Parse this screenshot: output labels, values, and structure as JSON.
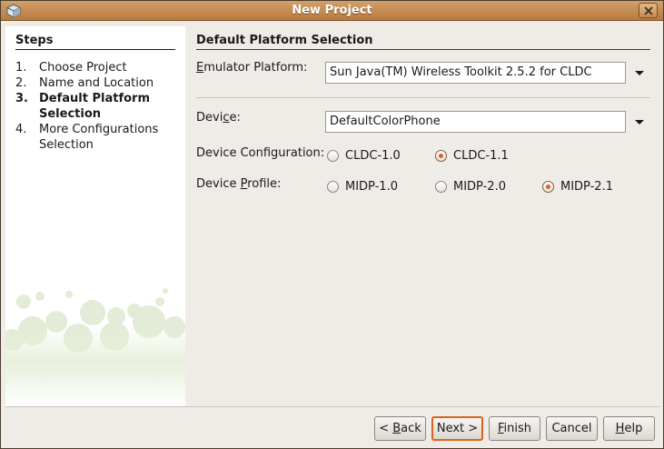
{
  "window": {
    "title": "New Project"
  },
  "steps": {
    "title": "Steps",
    "items": [
      {
        "num": "1.",
        "label": "Choose Project",
        "current": false
      },
      {
        "num": "2.",
        "label": "Name and Location",
        "current": false
      },
      {
        "num": "3.",
        "label": "Default Platform Selection",
        "current": true
      },
      {
        "num": "4.",
        "label": "More Configurations Selection",
        "current": false
      }
    ]
  },
  "main": {
    "title": "Default Platform Selection",
    "emulator": {
      "label_mnemonic": "E",
      "label_rest": "mulator Platform:",
      "value": "Sun Java(TM) Wireless Toolkit 2.5.2 for CLDC"
    },
    "device": {
      "label_pre": "Devi",
      "label_mnemonic": "c",
      "label_post": "e:",
      "value": "DefaultColorPhone"
    },
    "configuration": {
      "label": "Device Configuration:",
      "options": [
        {
          "label": "CLDC-1.0",
          "checked": false
        },
        {
          "label": "CLDC-1.1",
          "checked": true
        }
      ]
    },
    "profile": {
      "label_pre": "Device ",
      "label_mnemonic": "P",
      "label_post": "rofile:",
      "options": [
        {
          "label": "MIDP-1.0",
          "checked": false
        },
        {
          "label": "MIDP-2.0",
          "checked": false
        },
        {
          "label": "MIDP-2.1",
          "checked": true
        }
      ]
    }
  },
  "buttons": {
    "back_pre": "< ",
    "back_mnemonic": "B",
    "back_post": "ack",
    "next": "Next >",
    "finish_mnemonic": "F",
    "finish_post": "inish",
    "cancel": "Cancel",
    "help_mnemonic": "H",
    "help_post": "elp"
  },
  "colors": {
    "titlebar": "#c48b51",
    "accent": "#e0611d",
    "window_bg": "#efebe7"
  },
  "icons": {
    "window": "app-cube-icon",
    "close": "close-icon",
    "combo": "chevron-down-icon"
  }
}
